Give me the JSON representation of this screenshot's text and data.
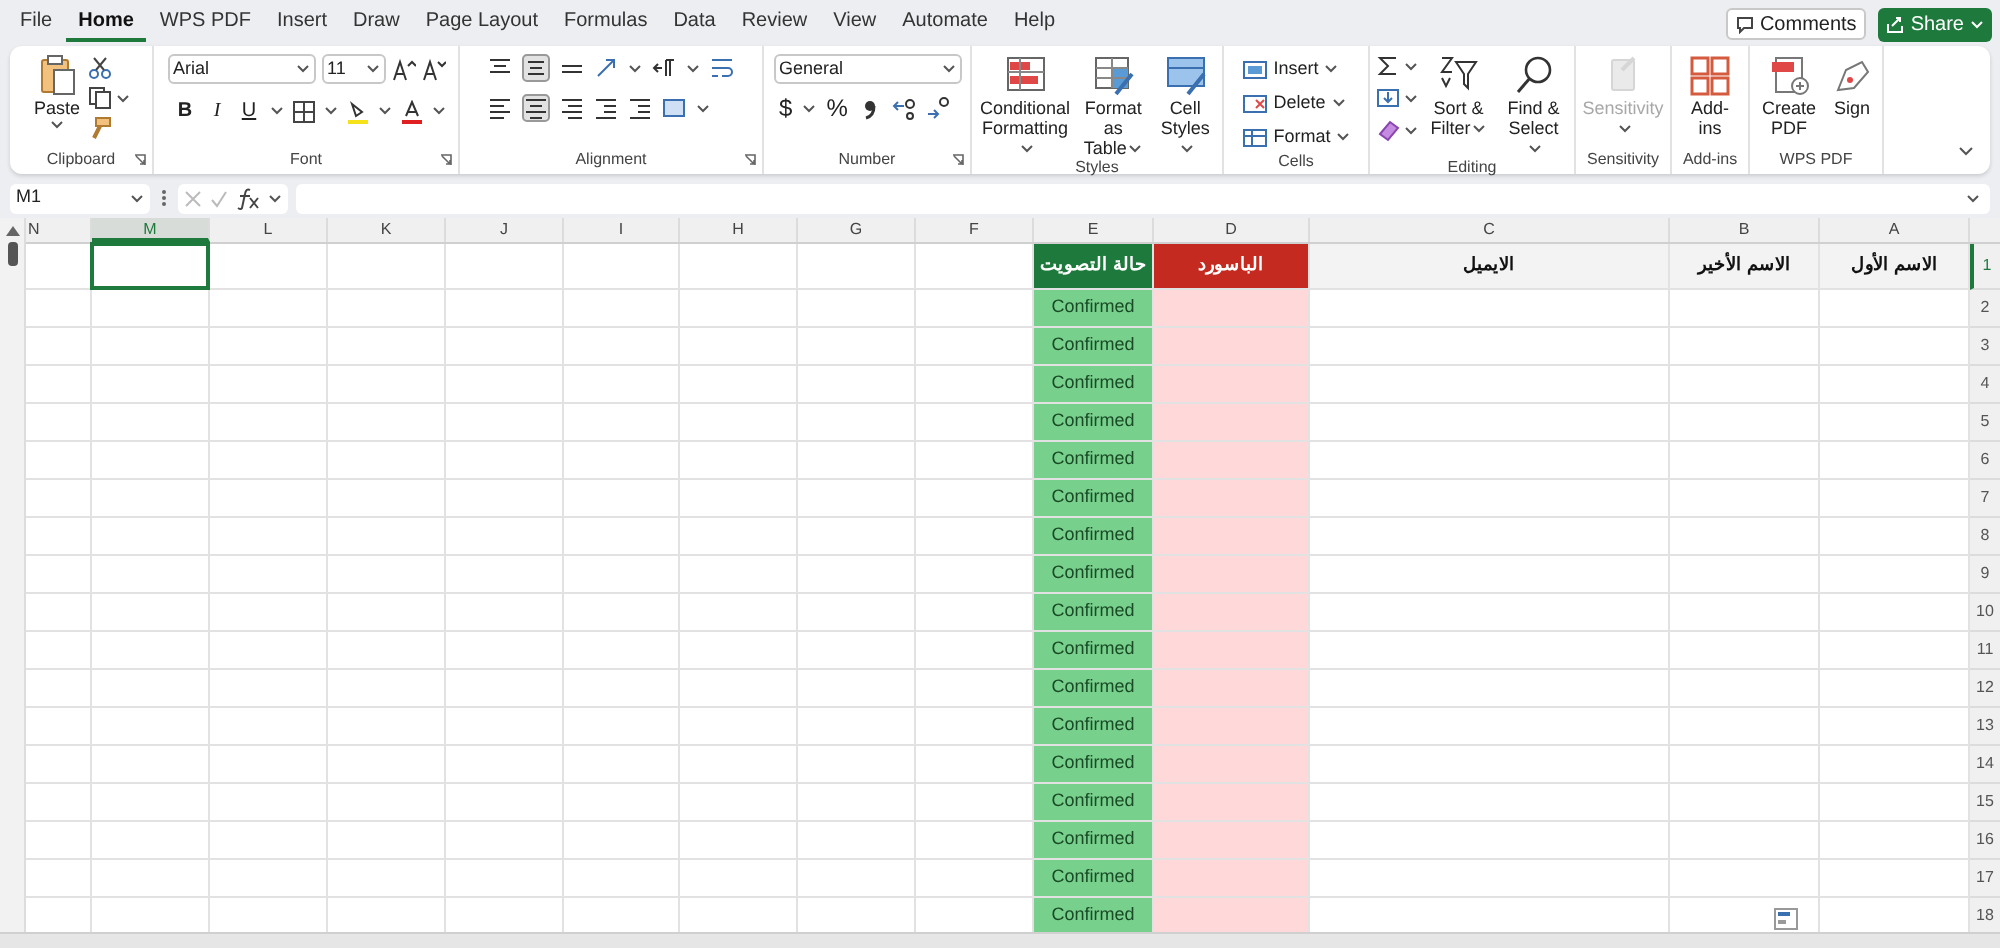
{
  "menu": [
    {
      "label": "File",
      "selected": false
    },
    {
      "label": "Home",
      "selected": true
    },
    {
      "label": "WPS PDF",
      "selected": false
    },
    {
      "label": "Insert",
      "selected": false
    },
    {
      "label": "Draw",
      "selected": false
    },
    {
      "label": "Page Layout",
      "selected": false
    },
    {
      "label": "Formulas",
      "selected": false
    },
    {
      "label": "Data",
      "selected": false
    },
    {
      "label": "Review",
      "selected": false
    },
    {
      "label": "View",
      "selected": false
    },
    {
      "label": "Automate",
      "selected": false
    },
    {
      "label": "Help",
      "selected": false
    }
  ],
  "comments_button": "Comments",
  "share_button": "Share",
  "ribbon": {
    "groups": [
      {
        "label": "Clipboard",
        "kind": "clipboard",
        "paste": "Paste"
      },
      {
        "label": "Font",
        "kind": "font",
        "font_name": "Arial",
        "font_size": "11",
        "style_buttons": [
          "B",
          "I",
          "U"
        ]
      },
      {
        "label": "Alignment",
        "kind": "alignment"
      },
      {
        "label": "Number",
        "kind": "number",
        "format": "General",
        "symbols": [
          "$",
          "%"
        ]
      },
      {
        "label": "Styles",
        "kind": "large",
        "buttons": [
          {
            "label": "Conditional Formatting",
            "menu": true,
            "disabled": false
          },
          {
            "label": "Format as Table",
            "menu": true,
            "disabled": false
          },
          {
            "label": "Cell Styles",
            "menu": true,
            "disabled": false
          }
        ]
      },
      {
        "label": "Cells",
        "kind": "cells",
        "buttons": [
          {
            "label": "Insert",
            "menu": true
          },
          {
            "label": "Delete",
            "menu": true
          },
          {
            "label": "Format",
            "menu": true
          }
        ]
      },
      {
        "label": "Editing",
        "kind": "editing",
        "buttons": [
          {
            "label": "Sort & Filter",
            "menu": true,
            "disabled": false
          },
          {
            "label": "Find & Select",
            "menu": true,
            "disabled": false
          }
        ]
      },
      {
        "label": "Sensitivity",
        "kind": "large",
        "buttons": [
          {
            "label": "Sensitivity",
            "menu": true,
            "disabled": true
          }
        ]
      },
      {
        "label": "Add-ins",
        "kind": "large",
        "buttons": [
          {
            "label": "Add-ins",
            "menu": false,
            "disabled": false
          }
        ]
      },
      {
        "label": "WPS PDF",
        "kind": "large",
        "buttons": [
          {
            "label": "Create PDF",
            "menu": false,
            "disabled": false
          },
          {
            "label": "Sign",
            "menu": false,
            "disabled": false
          }
        ]
      }
    ]
  },
  "name_box": "M1",
  "sheet": {
    "columns": [
      {
        "letter": "N",
        "selected": false
      },
      {
        "letter": "M",
        "selected": true
      },
      {
        "letter": "L",
        "selected": false
      },
      {
        "letter": "K",
        "selected": false
      },
      {
        "letter": "J",
        "selected": false
      },
      {
        "letter": "I",
        "selected": false
      },
      {
        "letter": "H",
        "selected": false
      },
      {
        "letter": "G",
        "selected": false
      },
      {
        "letter": "F",
        "selected": false
      },
      {
        "letter": "E",
        "selected": false
      },
      {
        "letter": "D",
        "selected": false
      },
      {
        "letter": "C",
        "selected": false
      },
      {
        "letter": "B",
        "selected": false
      },
      {
        "letter": "A",
        "selected": false
      }
    ],
    "rows": [
      {
        "number": "1",
        "kind": "header",
        "selected": true,
        "cells": [
          "الاسم الأول",
          "الاسم الأخير",
          "الايميل",
          "الباسورد",
          "حالة التصويت"
        ]
      },
      {
        "number": "2",
        "kind": "data",
        "selected": false,
        "status": "Confirmed"
      },
      {
        "number": "3",
        "kind": "data",
        "selected": false,
        "status": "Confirmed"
      },
      {
        "number": "4",
        "kind": "data",
        "selected": false,
        "status": "Confirmed"
      },
      {
        "number": "5",
        "kind": "data",
        "selected": false,
        "status": "Confirmed"
      },
      {
        "number": "6",
        "kind": "data",
        "selected": false,
        "status": "Confirmed"
      },
      {
        "number": "7",
        "kind": "data",
        "selected": false,
        "status": "Confirmed"
      },
      {
        "number": "8",
        "kind": "data",
        "selected": false,
        "status": "Confirmed"
      },
      {
        "number": "9",
        "kind": "data",
        "selected": false,
        "status": "Confirmed"
      },
      {
        "number": "10",
        "kind": "data",
        "selected": false,
        "status": "Confirmed"
      },
      {
        "number": "11",
        "kind": "data",
        "selected": false,
        "status": "Confirmed"
      },
      {
        "number": "12",
        "kind": "data",
        "selected": false,
        "status": "Confirmed"
      },
      {
        "number": "13",
        "kind": "data",
        "selected": false,
        "status": "Confirmed"
      },
      {
        "number": "14",
        "kind": "data",
        "selected": false,
        "status": "Confirmed"
      },
      {
        "number": "15",
        "kind": "data",
        "selected": false,
        "status": "Confirmed"
      },
      {
        "number": "16",
        "kind": "data",
        "selected": false,
        "status": "Confirmed"
      },
      {
        "number": "17",
        "kind": "data",
        "selected": false,
        "status": "Confirmed"
      },
      {
        "number": "18",
        "kind": "data",
        "selected": false,
        "status": "Confirmed"
      }
    ]
  }
}
